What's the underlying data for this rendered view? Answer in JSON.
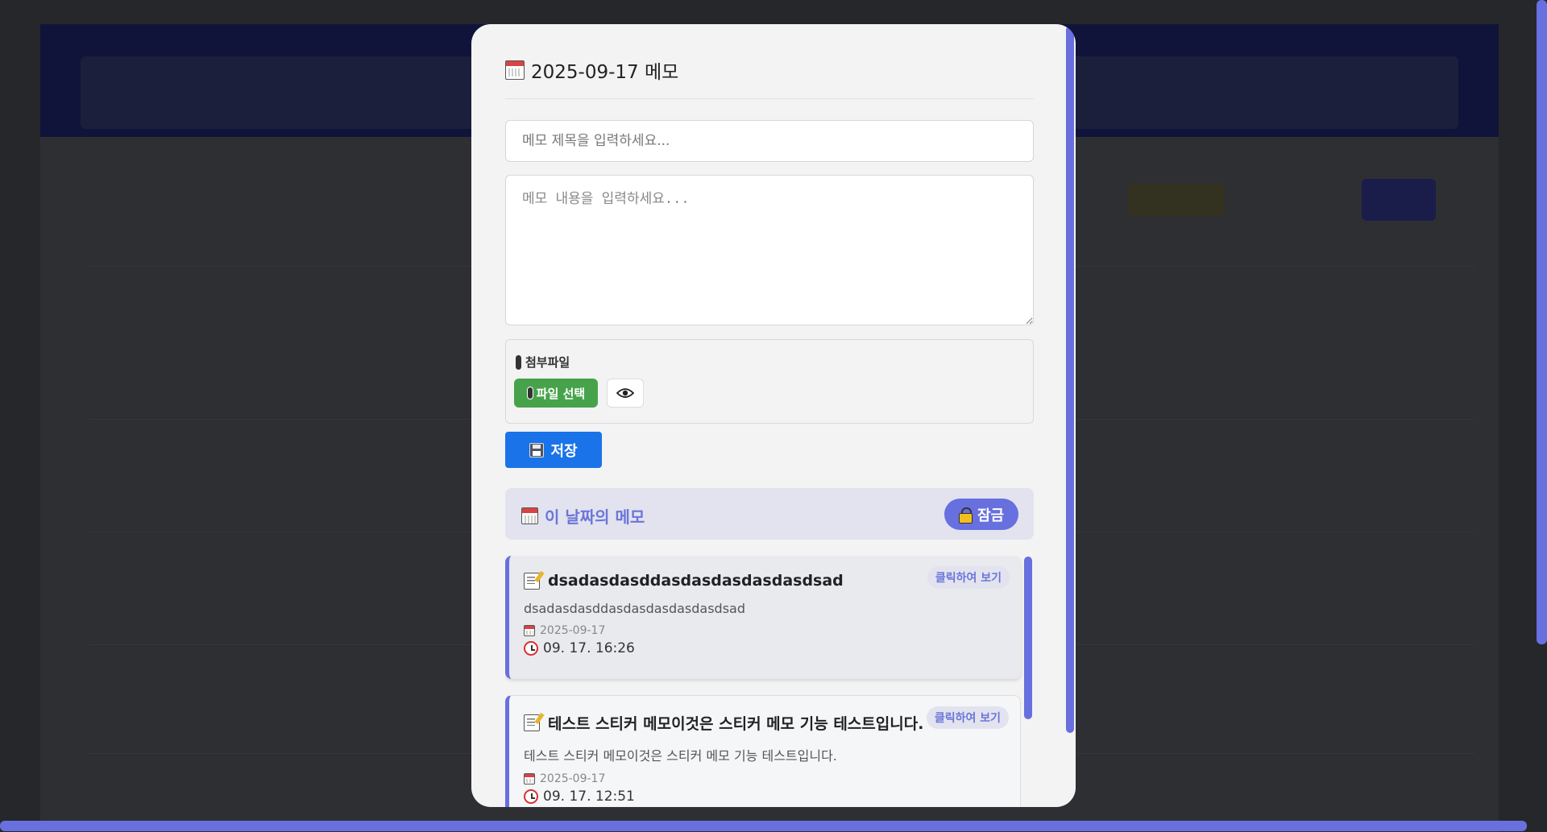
{
  "modal": {
    "title": "2025-09-17 메모",
    "title_placeholder": "메모 제목을 입력하세요...",
    "content_placeholder": "메모 내용을 입력하세요...",
    "attachments": {
      "label": "첨부파일",
      "file_button": "파일 선택"
    },
    "save_label": "저장"
  },
  "memo_list": {
    "header_title": "이 날짜의 메모",
    "lock_label": "잠금",
    "items": [
      {
        "title": "dsadasdasddasdasdasdasdasdsad",
        "content": "dsadasdasddasdasdasdasdasdsad",
        "date": "2025-09-17",
        "time": "09. 17. 16:26",
        "view_label": "클릭하여 보기"
      },
      {
        "title": "테스트 스티커 메모이것은 스티커 메모 기능 테스트입니다.",
        "content": "테스트 스티커 메모이것은 스티커 메모 기능 테스트입니다.",
        "date": "2025-09-17",
        "time": "09. 17. 12:51",
        "view_label": "클릭하여 보기"
      }
    ]
  },
  "colors": {
    "accent": "#6770de",
    "save_button": "#1a73e8",
    "file_button": "#47a34b"
  },
  "icons": [
    "calendar-icon",
    "paperclip-icon",
    "eye-icon",
    "floppy-disk-icon",
    "lock-icon",
    "memo-icon",
    "alarm-clock-icon"
  ]
}
